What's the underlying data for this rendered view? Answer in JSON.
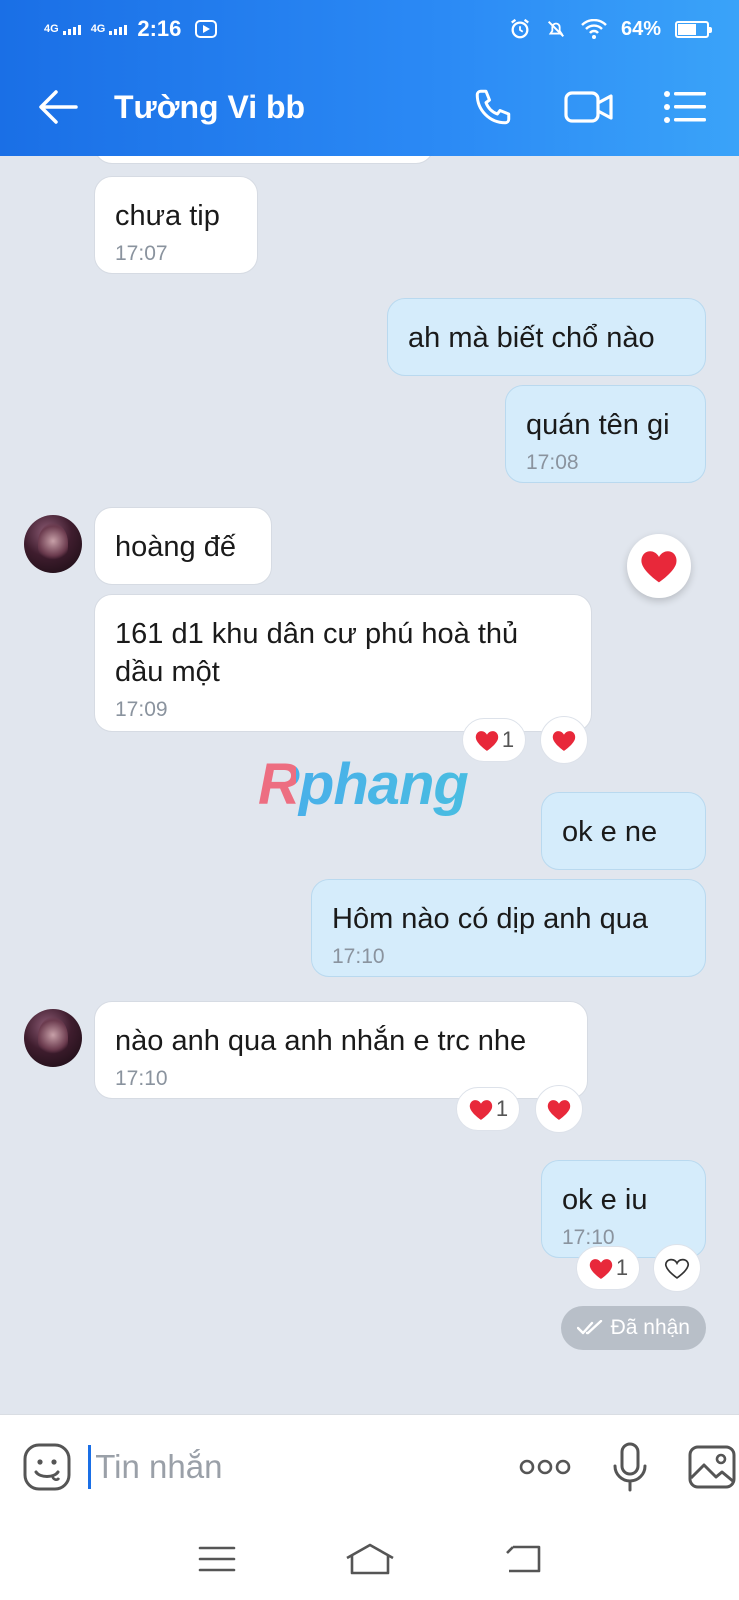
{
  "status_bar": {
    "net1": "4G",
    "net2": "4G",
    "time": "2:16",
    "battery": "64%",
    "battery_level": 0.64
  },
  "header": {
    "contact_name": "Tường Vi bb",
    "icons": [
      "back-arrow-icon",
      "phone-icon",
      "video-icon",
      "menu-icon"
    ]
  },
  "messages": [
    {
      "side": "in",
      "text": "chưa tip",
      "time": "17:07"
    },
    {
      "side": "out",
      "text": "ah mà biết chổ nào",
      "time": ""
    },
    {
      "side": "out",
      "text": "quán tên gi",
      "time": "17:08"
    },
    {
      "side": "in",
      "text": "hoàng đế",
      "time": ""
    },
    {
      "side": "in",
      "text": "161 d1 khu dân cư phú hoà thủ dầu một",
      "time": "17:09",
      "reaction_count": "1"
    },
    {
      "side": "out",
      "text": "ok e ne",
      "time": ""
    },
    {
      "side": "out",
      "text": "Hôm nào có dịp anh qua",
      "time": "17:10"
    },
    {
      "side": "in",
      "text": "nào anh qua anh nhắn e trc nhe",
      "time": "17:10",
      "reaction_count": "1"
    },
    {
      "side": "out",
      "text": "ok e iu",
      "time": "17:10",
      "reaction_count": "1"
    }
  ],
  "watermark": "Rphang",
  "delivery_status": "Đã nhận",
  "input": {
    "placeholder": "Tin nhắn"
  },
  "colors": {
    "accent": "#1a6fe6",
    "heart": "#e8283a",
    "outgoing_bubble": "#d5ecfb",
    "background": "#e1e6ee"
  }
}
